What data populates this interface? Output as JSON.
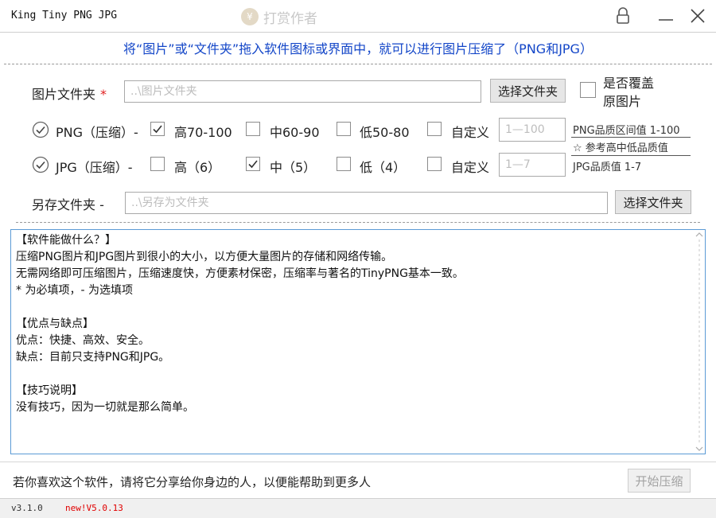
{
  "window": {
    "title": "King Tiny PNG JPG",
    "donate_label": "打赏作者",
    "donate_icon": "coin-icon"
  },
  "banner": {
    "text": "将“图片”或“文件夹”拖入软件图标或界面中，就可以进行图片压缩了（PNG和JPG）"
  },
  "source_folder": {
    "label": "图片文件夹",
    "required_mark": "*",
    "placeholder": "..\\图片文件夹",
    "button": "选择文件夹"
  },
  "overwrite": {
    "label_line1": "是否覆盖",
    "label_line2": "原图片",
    "checked": false
  },
  "png": {
    "label": "PNG（压缩）-",
    "enabled": true,
    "options": [
      {
        "label": "高70-100",
        "checked": true
      },
      {
        "label": "中60-90",
        "checked": false
      },
      {
        "label": "低50-80",
        "checked": false
      },
      {
        "label": "自定义",
        "checked": false
      }
    ],
    "custom_placeholder": "1—100"
  },
  "jpg": {
    "label": "JPG（压缩）-",
    "enabled": true,
    "options": [
      {
        "label": "高（6）",
        "checked": false
      },
      {
        "label": "中（5）",
        "checked": true
      },
      {
        "label": "低（4）",
        "checked": false
      },
      {
        "label": "自定义",
        "checked": false
      }
    ],
    "custom_placeholder": "1—7"
  },
  "hints": {
    "png_range": "PNG品质区间值 1-100",
    "reference": "☆ 参考高中低品质值",
    "jpg_value": "JPG品质值 1-7"
  },
  "output_folder": {
    "label": "另存文件夹 -",
    "placeholder": "..\\另存为文件夹",
    "button": "选择文件夹"
  },
  "info": {
    "lines": [
      "【软件能做什么？】",
      "压缩PNG图片和JPG图片到很小的大小，以方便大量图片的存储和网络传输。",
      "无需网络即可压缩图片，压缩速度快，方便素材保密，压缩率与著名的TinyPNG基本一致。",
      "* 为必填项，- 为选填项",
      "",
      "【优点与缺点】",
      "优点：快捷、高效、安全。",
      "缺点：目前只支持PNG和JPG。",
      "",
      "【技巧说明】",
      "没有技巧，因为一切就是那么简单。"
    ]
  },
  "footer": {
    "share_text": "若你喜欢这个软件，请将它分享给你身边的人，以便能帮助到更多人",
    "start_button": "开始压缩"
  },
  "status": {
    "version": "v3.1.0",
    "new_version": "new!V5.0.13"
  }
}
